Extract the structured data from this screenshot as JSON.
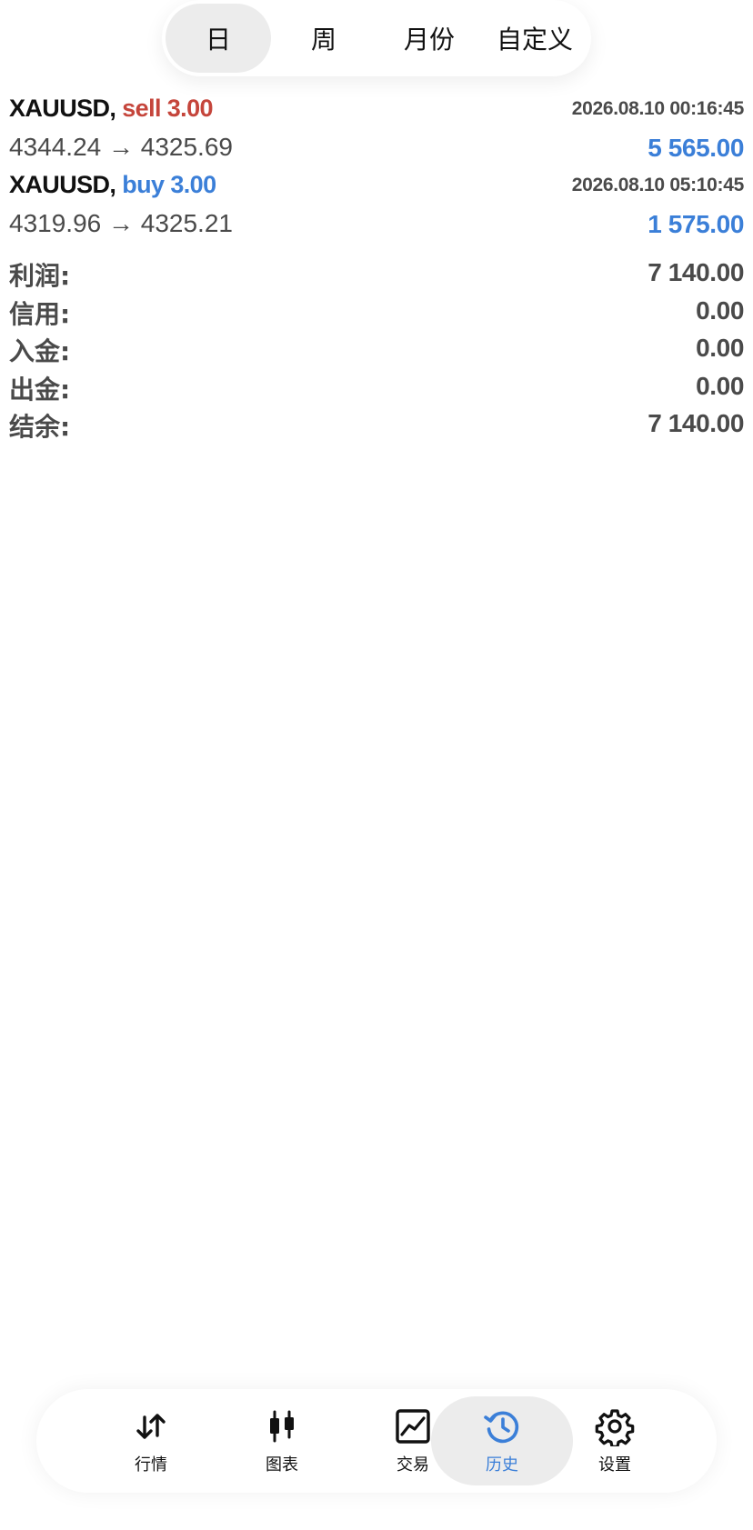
{
  "period_tabs": [
    "日",
    "周",
    "月份",
    "自定义"
  ],
  "active_period": "日",
  "deals": [
    {
      "symbol": "XAUUSD,",
      "type_label": "sell 3.00",
      "time": "2026.08.10 00:16:45",
      "price_line": "4344.24 → 4325.69",
      "profit": "5 565.00"
    },
    {
      "symbol": "XAUUSD,",
      "type_label": "buy 3.00",
      "time": "2026.08.10 05:10:45",
      "price_line": "4319.96 → 4325.21",
      "profit": "1 575.00"
    }
  ],
  "summary": [
    {
      "label": "利润:",
      "value": "7 140.00"
    },
    {
      "label": "信用:",
      "value": "0.00"
    },
    {
      "label": "入金:",
      "value": "0.00"
    },
    {
      "label": "出金:",
      "value": "0.00"
    },
    {
      "label": "结余:",
      "value": "7 140.00"
    }
  ],
  "nav": [
    {
      "label": "行情",
      "icon": "quotes-arrows-icon"
    },
    {
      "label": "图表",
      "icon": "candlestick-chart-icon"
    },
    {
      "label": "交易",
      "icon": "trade-line-chart-icon"
    },
    {
      "label": "历史",
      "icon": "history-clock-icon"
    },
    {
      "label": "设置",
      "icon": "gear-icon"
    }
  ],
  "active_nav": "历史",
  "colors": {
    "sell": "#c5453b",
    "buy_profit": "#3b7fd8",
    "text_gray": "#4a4a4a",
    "active_bg": "#ececec"
  }
}
